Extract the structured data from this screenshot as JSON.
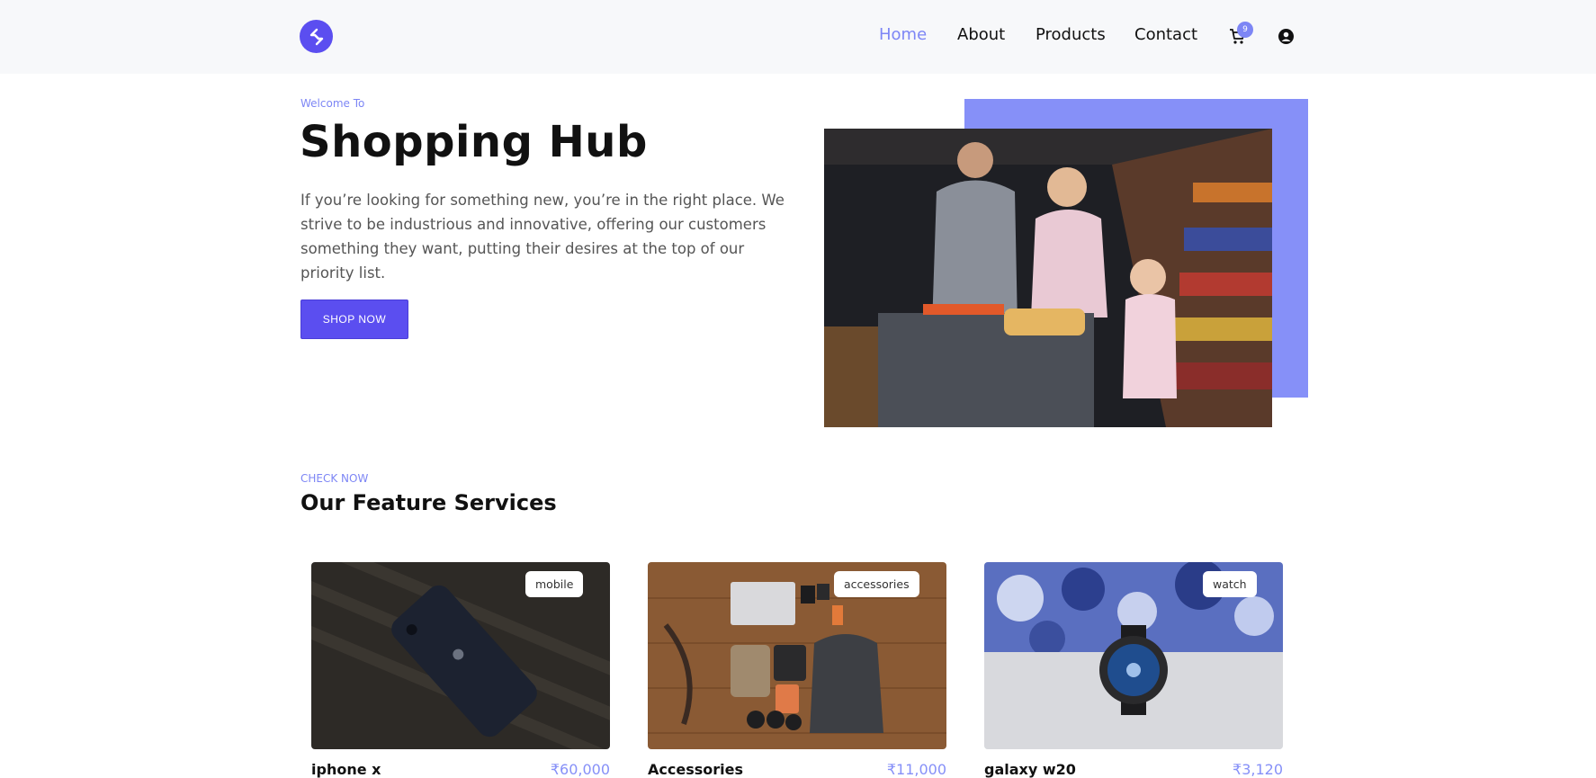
{
  "nav": {
    "logo": "logo-icon",
    "links": [
      "Home",
      "About",
      "Products",
      "Contact"
    ],
    "active": "Home",
    "cart_count": "9",
    "cart_icon": "cart-icon",
    "user_icon": "user-icon"
  },
  "hero": {
    "eyebrow": "Welcome To",
    "title": "Shopping Hub",
    "text": "If you’re looking for something new, you’re in the right place. We strive to be industrious and innovative, offering our customers something they want, putting their desires at the top of our priority list.",
    "cta": "SHOP NOW"
  },
  "features": {
    "eyebrow": "CHECK NOW",
    "title": "Our Feature Services",
    "cards": [
      {
        "tag": "mobile",
        "name": "iphone x",
        "price": "₹60,000"
      },
      {
        "tag": "accessories",
        "name": "Accessories",
        "price": "₹11,000"
      },
      {
        "tag": "watch",
        "name": "galaxy w20",
        "price": "₹3,120"
      }
    ]
  },
  "colors": {
    "accent": "#7d86f5",
    "brand": "#5b4ef0",
    "header_bg": "#f7f8fa"
  }
}
